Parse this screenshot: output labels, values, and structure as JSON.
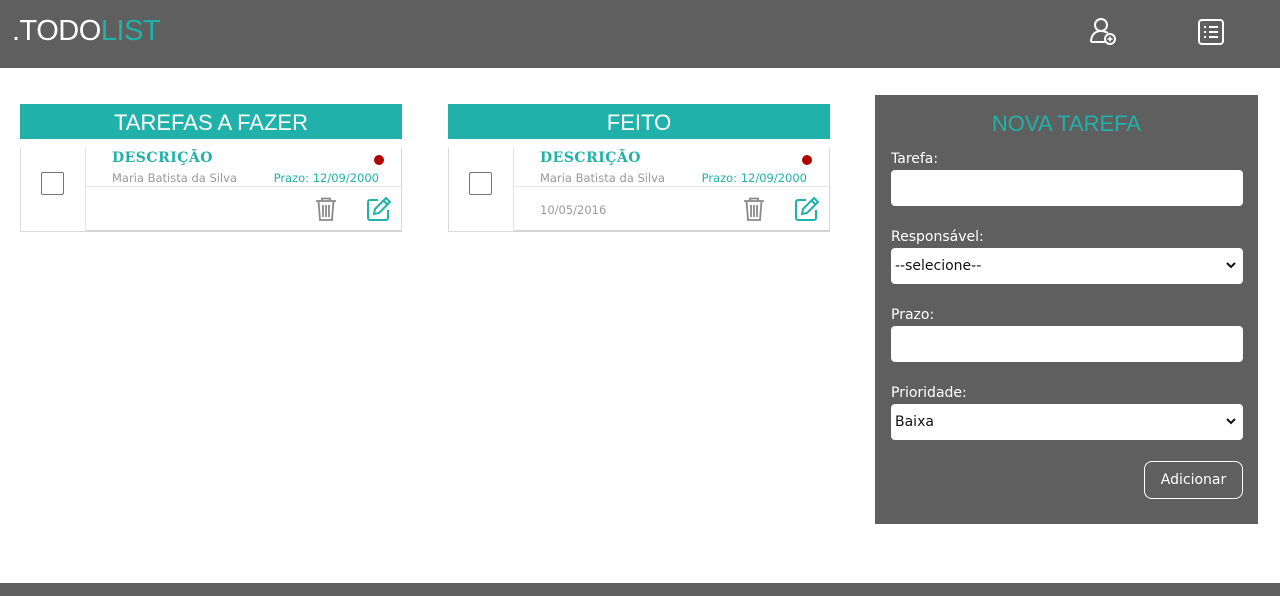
{
  "header": {
    "logo_prefix": ".TODO",
    "logo_accent": "LIST",
    "icons": [
      "add-user-icon",
      "list-icon"
    ]
  },
  "columns": {
    "todo": {
      "title": "TAREFAS A FAZER",
      "card": {
        "description": "DESCRIÇÃO",
        "owner": "Maria Batista da Silva",
        "deadline": "Prazo: 12/09/2000",
        "done_date": ""
      }
    },
    "done": {
      "title": "FEITO",
      "card": {
        "description": "DESCRIÇÃO",
        "owner": "Maria Batista da Silva",
        "deadline": "Prazo: 12/09/2000",
        "done_date": "10/05/2016"
      }
    }
  },
  "form": {
    "title": "NOVA TAREFA",
    "task_label": "Tarefa:",
    "task_value": "",
    "owner_label": "Responsável:",
    "owner_selected": "--selecione--",
    "deadline_label": "Prazo:",
    "deadline_value": "",
    "priority_label": "Prioridade:",
    "priority_selected": "Baixa",
    "submit_label": "Adicionar"
  },
  "colors": {
    "accent": "#20b2aa",
    "header_bg": "#5f5f5f",
    "priority_dot": "#b00000"
  }
}
